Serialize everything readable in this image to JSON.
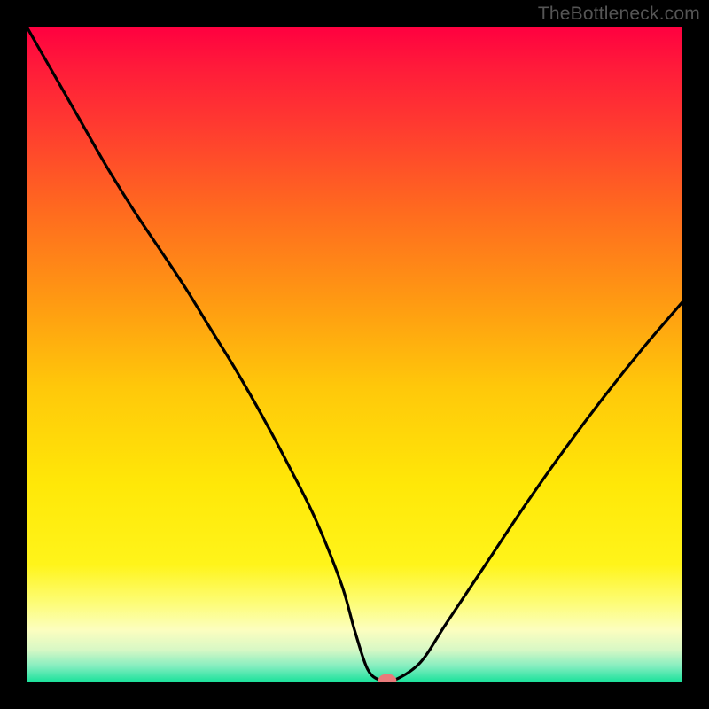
{
  "watermark": "TheBottleneck.com",
  "chart_data": {
    "type": "line",
    "title": "",
    "xlabel": "",
    "ylabel": "",
    "xlim": [
      0,
      100
    ],
    "ylim": [
      0,
      100
    ],
    "background_gradient": {
      "stops": [
        {
          "offset": 0.0,
          "color": "#ff0040"
        },
        {
          "offset": 0.06,
          "color": "#ff1a3a"
        },
        {
          "offset": 0.15,
          "color": "#ff3a30"
        },
        {
          "offset": 0.28,
          "color": "#ff6a1f"
        },
        {
          "offset": 0.42,
          "color": "#ff9a12"
        },
        {
          "offset": 0.55,
          "color": "#ffc80a"
        },
        {
          "offset": 0.7,
          "color": "#ffe808"
        },
        {
          "offset": 0.82,
          "color": "#fff41a"
        },
        {
          "offset": 0.88,
          "color": "#fdfd79"
        },
        {
          "offset": 0.92,
          "color": "#fcfebf"
        },
        {
          "offset": 0.95,
          "color": "#d8f8c5"
        },
        {
          "offset": 0.975,
          "color": "#86eec0"
        },
        {
          "offset": 1.0,
          "color": "#17e19a"
        }
      ]
    },
    "series": [
      {
        "name": "bottleneck-curve",
        "color": "#000000",
        "x": [
          0,
          4,
          8,
          12,
          16,
          20,
          24,
          28,
          32,
          36,
          40,
          44,
          48,
          50,
          52,
          54,
          56,
          60,
          64,
          70,
          76,
          82,
          88,
          94,
          100
        ],
        "y": [
          100,
          93,
          86,
          79,
          72.5,
          66.5,
          60.5,
          54,
          47.5,
          40.5,
          33,
          25,
          15,
          8,
          2,
          0.3,
          0.3,
          3,
          9,
          18,
          27,
          35.5,
          43.5,
          51,
          58
        ]
      }
    ],
    "marker": {
      "x": 55,
      "y": 0.3,
      "color": "#e97b7b",
      "rx": 1.4,
      "ry": 1.0
    }
  }
}
